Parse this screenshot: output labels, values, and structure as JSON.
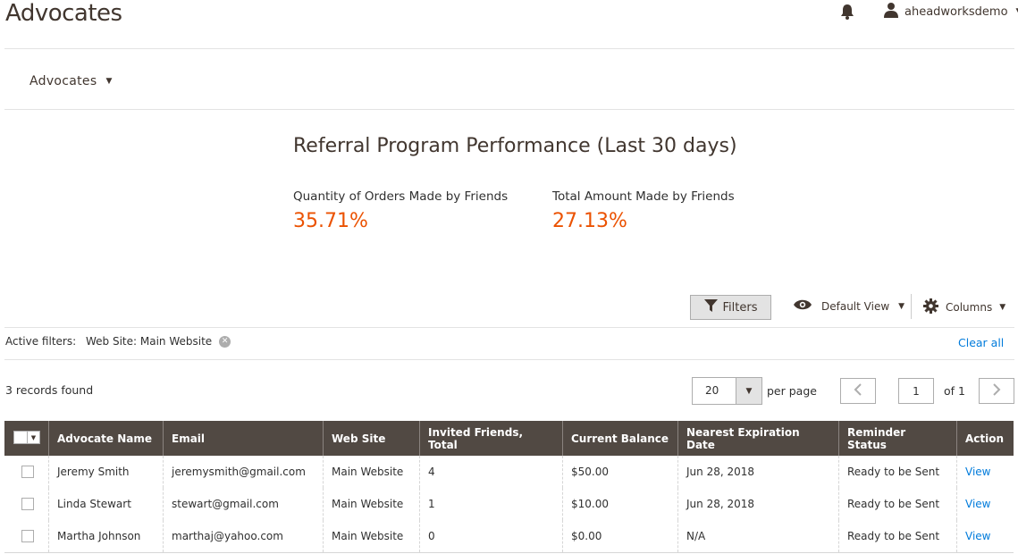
{
  "header": {
    "page_title": "Advocates",
    "username": "aheadworksdemo"
  },
  "switcher": {
    "label": "Advocates"
  },
  "performance": {
    "title": "Referral Program Performance (Last 30 days)",
    "metrics": [
      {
        "label": "Quantity of Orders Made by Friends",
        "value": "35.71%"
      },
      {
        "label": "Total Amount Made by Friends",
        "value": "27.13%"
      }
    ]
  },
  "toolbar": {
    "filters_label": "Filters",
    "view_label": "Default View",
    "columns_label": "Columns"
  },
  "active_filters": {
    "label": "Active filters:",
    "chip": "Web Site: Main Website",
    "clear_all": "Clear all"
  },
  "records_found": "3 records found",
  "pagination": {
    "per_page_value": "20",
    "per_page_label": "per page",
    "current_page": "1",
    "of_label": "of 1"
  },
  "grid": {
    "columns": [
      "Advocate Name",
      "Email",
      "Web Site",
      "Invited Friends, Total",
      "Current Balance",
      "Nearest Expiration Date",
      "Reminder Status",
      "Action"
    ],
    "rows": [
      [
        "Jeremy Smith",
        "jeremysmith@gmail.com",
        "Main Website",
        "4",
        "$50.00",
        "Jun 28, 2018",
        "Ready to be Sent",
        "View"
      ],
      [
        "Linda Stewart",
        "stewart@gmail.com",
        "Main Website",
        "1",
        "$10.00",
        "Jun 28, 2018",
        "Ready to be Sent",
        "View"
      ],
      [
        "Martha Johnson",
        "marthaj@yahoo.com",
        "Main Website",
        "0",
        "$0.00",
        "N/A",
        "Ready to be Sent",
        "View"
      ]
    ]
  },
  "colors": {
    "accent": "#eb5202",
    "link": "#007bdb",
    "grid_header": "#514943"
  }
}
